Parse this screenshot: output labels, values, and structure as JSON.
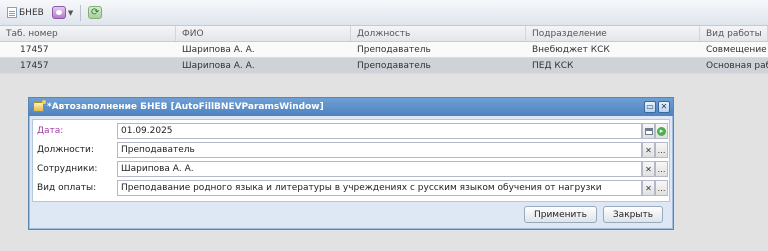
{
  "toolbar": {
    "bnev_label": "БНЕВ"
  },
  "grid": {
    "columns": [
      "Таб. номер",
      "ФИО",
      "Должность",
      "Подразделение",
      "Вид работы"
    ],
    "rows": [
      {
        "tab": "17457",
        "fio": "Шарипова А. А.",
        "position": "Преподаватель",
        "unit": "Внебюджет КСК",
        "work": "Совмещение"
      },
      {
        "tab": "17457",
        "fio": "Шарипова А. А.",
        "position": "Преподаватель",
        "unit": "ПЕД КСК",
        "work": "Основная работа"
      }
    ]
  },
  "modal": {
    "title": "*Автозаполнение БНЕВ [AutoFillBNEVParamsWindow]",
    "fields": {
      "date": {
        "label": "Дата:",
        "value": "01.09.2025"
      },
      "positions": {
        "label": "Должности:",
        "value": "Преподаватель"
      },
      "employees": {
        "label": "Сотрудники:",
        "value": "Шарипова А. А."
      },
      "payment": {
        "label": "Вид оплаты:",
        "value": "Преподавание родного языка и литературы в учреждениях с русским языком обучения от нагрузки"
      }
    },
    "apply_label": "Применить",
    "close_label": "Закрыть"
  },
  "colors": {
    "modal_header": "#5a8fd0",
    "required_label": "#9c3da0",
    "selected_row": "#cfd2d6"
  }
}
